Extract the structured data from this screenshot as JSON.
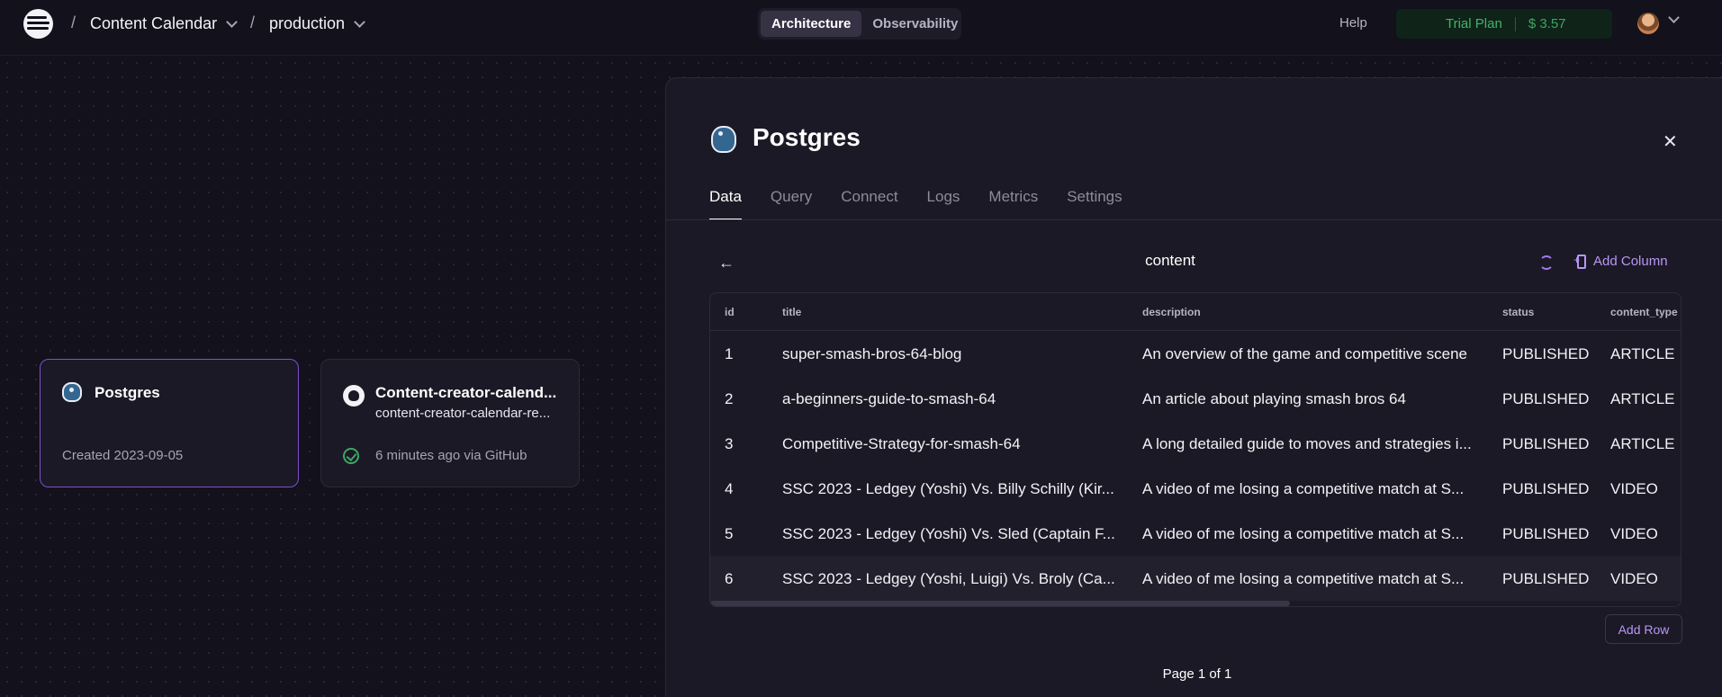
{
  "header": {
    "project": "Content Calendar",
    "environment": "production",
    "segments": [
      "Architecture",
      "Observability"
    ],
    "help": "Help",
    "plan": "Trial Plan",
    "usage": "$ 3.57"
  },
  "canvas": {
    "cards": [
      {
        "title": "Postgres",
        "footer": "Created 2023-09-05"
      },
      {
        "title": "Content-creator-calend...",
        "subtitle": "content-creator-calendar-re...",
        "footer": "6 minutes ago via GitHub"
      }
    ]
  },
  "panel": {
    "title": "Postgres",
    "tabs": [
      "Data",
      "Query",
      "Connect",
      "Logs",
      "Metrics",
      "Settings"
    ],
    "table_name": "content",
    "add_column": "Add Column",
    "add_row": "Add Row",
    "pagination": "Page 1 of 1",
    "columns": [
      "id",
      "title",
      "description",
      "status",
      "content_type"
    ],
    "rows": [
      {
        "id": "1",
        "title": "super-smash-bros-64-blog",
        "description": "An overview of the game and competitive scene",
        "status": "PUBLISHED",
        "content_type": "ARTICLE"
      },
      {
        "id": "2",
        "title": "a-beginners-guide-to-smash-64",
        "description": "An article about playing smash bros 64",
        "status": "PUBLISHED",
        "content_type": "ARTICLE"
      },
      {
        "id": "3",
        "title": "Competitive-Strategy-for-smash-64",
        "description": "A long detailed guide to moves and strategies i...",
        "status": "PUBLISHED",
        "content_type": "ARTICLE"
      },
      {
        "id": "4",
        "title": "SSC 2023 - Ledgey (Yoshi) Vs. Billy Schilly (Kir...",
        "description": "A video of me losing a competitive match at S...",
        "status": "PUBLISHED",
        "content_type": "VIDEO"
      },
      {
        "id": "5",
        "title": "SSC 2023 - Ledgey (Yoshi) Vs. Sled (Captain F...",
        "description": "A video of me losing a competitive match at S...",
        "status": "PUBLISHED",
        "content_type": "VIDEO"
      },
      {
        "id": "6",
        "title": "SSC 2023 - Ledgey (Yoshi, Luigi) Vs. Broly (Ca...",
        "description": "A video of me losing a competitive match at S...",
        "status": "PUBLISHED",
        "content_type": "VIDEO"
      }
    ]
  }
}
